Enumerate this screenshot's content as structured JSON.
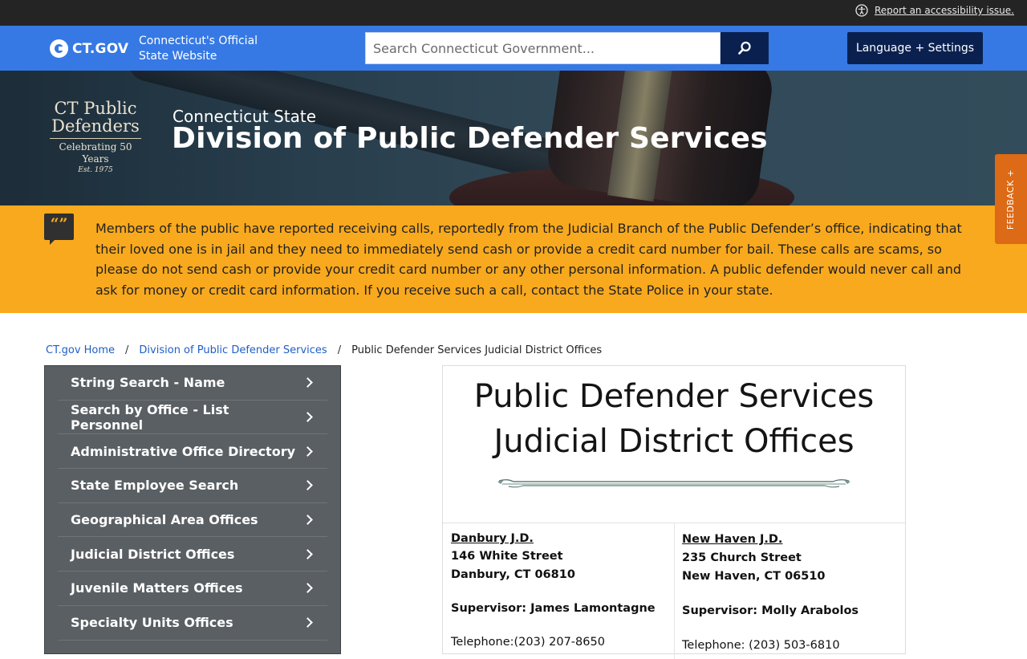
{
  "utility": {
    "accessibility_link": "Report an accessibility issue."
  },
  "header": {
    "logo_text": "CT.GOV",
    "tagline": "Connecticut's Official State Website",
    "search_placeholder": "Search Connecticut Government...",
    "language_button": "Language + Settings"
  },
  "hero": {
    "logo_line1": "CT Public",
    "logo_line2": "Defenders",
    "logo_line3": "Celebrating 50 Years",
    "logo_line4": "Est. 1975",
    "subtitle": "Connecticut State",
    "title": "Division of Public Defender Services"
  },
  "feedback": {
    "label": "FEEDBACK +"
  },
  "alert": {
    "icon_glyph": "“”",
    "text": "Members of the public have reported receiving calls, reportedly from the Judicial Branch of the Public Defender’s office, indicating that their loved one is in jail and they need to immediately send cash or provide a credit card number for bail. These calls are scams, so please do not send cash or provide your credit card number or any other personal information. A public defender would never call and ask for money or credit card information. If you receive such a call, contact the State Police in your state."
  },
  "breadcrumb": {
    "home": "CT.gov Home",
    "division": "Division of Public Defender Services",
    "current": "Public Defender Services Judicial District Offices",
    "separator": "/"
  },
  "sidebar": {
    "items": [
      {
        "label": "String Search - Name"
      },
      {
        "label": "Search by Office - List Personnel"
      },
      {
        "label": "Administrative Office Directory"
      },
      {
        "label": "State Employee Search"
      },
      {
        "label": "Geographical Area Offices"
      },
      {
        "label": "Judicial District Offices"
      },
      {
        "label": "Juvenile Matters Offices"
      },
      {
        "label": "Specialty Units Offices"
      }
    ]
  },
  "content": {
    "title_line1": "Public Defender Services",
    "title_line2": "Judicial District Offices",
    "offices": [
      {
        "name": "Danbury J.D.",
        "street": "146 White Street",
        "city": "Danbury, CT 06810",
        "supervisor": "Supervisor: James Lamontagne",
        "telephone": "Telephone:(203) 207-8650"
      },
      {
        "name": "New Haven J.D.",
        "street": "235 Church Street",
        "city": "New Haven, CT 06510",
        "supervisor": "Supervisor: Molly Arabolos",
        "telephone": "Telephone: (203) 503-6810"
      }
    ]
  },
  "colors": {
    "utility_bar": "#242424",
    "header_blue": "#3679e4",
    "navy": "#0a2150",
    "alert_orange": "#f9a91d",
    "feedback_orange": "#dc6a16",
    "sidebar_gray": "#5a5f63",
    "link_blue": "#1f5ec7"
  },
  "icons": {
    "accessibility": "accessibility-icon",
    "search": "search-icon",
    "alert": "quote-bubble-icon",
    "chevron": "chevron-right-icon",
    "ornament": "divider-ornament-icon"
  }
}
